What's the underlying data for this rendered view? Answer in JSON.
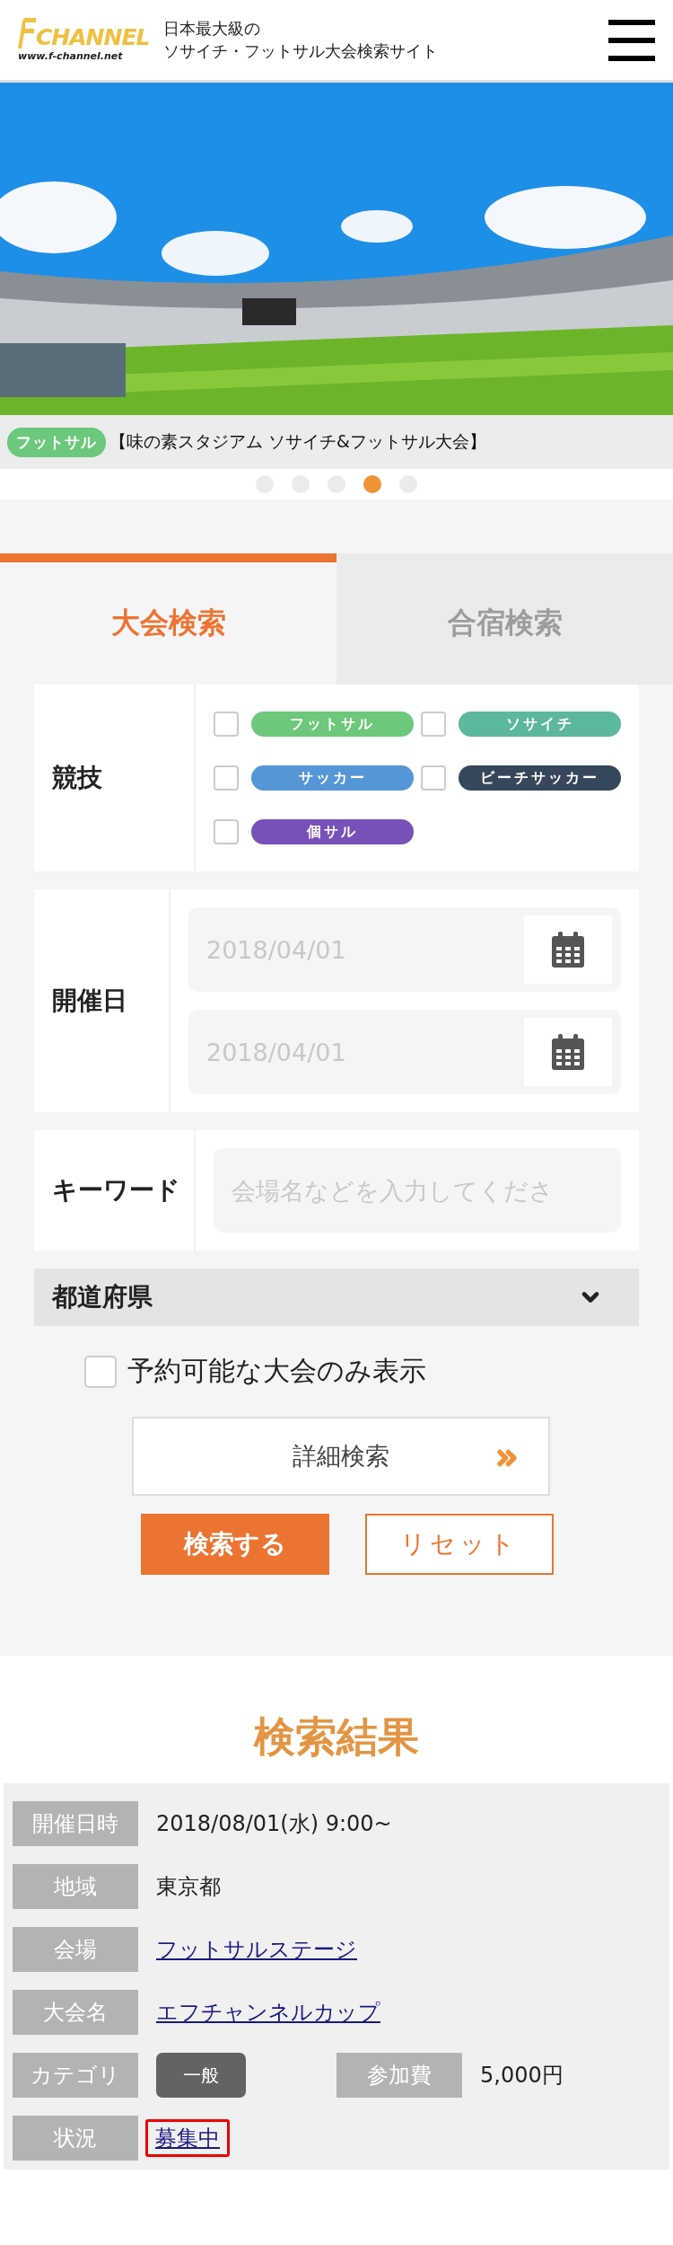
{
  "header": {
    "logo": {
      "name": "CHANNEL",
      "url": "www.f-channel.net"
    },
    "tagline": [
      "日本最大級の",
      "ソサイチ・フットサル大会検索サイト"
    ]
  },
  "banner": {
    "kind": "picture",
    "tag": {
      "label": "フットサル",
      "color": "#6cc87a"
    },
    "caption": "【味の素スタジアム ソサイチ&フットサル大会】",
    "dots": [
      {
        "selected": false
      },
      {
        "selected": false
      },
      {
        "selected": false
      },
      {
        "selected": true
      },
      {
        "selected": false
      }
    ]
  },
  "tabs": [
    {
      "label": "大会検索",
      "selected": true
    },
    {
      "label": "合宿検索",
      "selected": false
    }
  ],
  "form": {
    "sports": {
      "label": "競技",
      "options": [
        {
          "label": "フットサル",
          "color": "#6cc87a",
          "checked": false
        },
        {
          "label": "ソサイチ",
          "color": "#5cb89d",
          "checked": false
        },
        {
          "label": "サッカー",
          "color": "#5597d6",
          "checked": false
        },
        {
          "label": "ビーチサッカー",
          "color": "#37475b",
          "checked": false
        },
        {
          "label": "個サル",
          "color": "#7651b8",
          "checked": false
        }
      ]
    },
    "date": {
      "label": "開催日",
      "fields": [
        {
          "placeholder": "2018/04/01"
        },
        {
          "placeholder": "2018/04/01"
        }
      ]
    },
    "keyword": {
      "label": "キーワード",
      "placeholder": "会場名などを入力してくださ"
    },
    "prefecture": {
      "label": "都道府県",
      "expanded": false
    },
    "reservable": {
      "label": "予約可能な大会のみ表示",
      "checked": false
    },
    "detail_button": "詳細検索",
    "search_button": "検索する",
    "reset_button": "リセット"
  },
  "results": {
    "title": "検索結果",
    "rows": [
      [
        {
          "label": "開催日時",
          "value": "2018/08/01(水) 9:00~",
          "kind": "text"
        }
      ],
      [
        {
          "label": "地域",
          "value": "東京都",
          "kind": "text"
        }
      ],
      [
        {
          "label": "会場",
          "value": "フットサルステージ",
          "kind": "link"
        }
      ],
      [
        {
          "label": "大会名",
          "value": "エフチャンネルカップ",
          "kind": "link"
        }
      ],
      [
        {
          "label": "カテゴリ",
          "value": "一般",
          "kind": "badge"
        },
        {
          "label": "参加費",
          "value": "5,000円",
          "kind": "text"
        }
      ],
      [
        {
          "label": "状況",
          "value": "募集中",
          "kind": "link",
          "highlighted": true
        }
      ]
    ]
  }
}
